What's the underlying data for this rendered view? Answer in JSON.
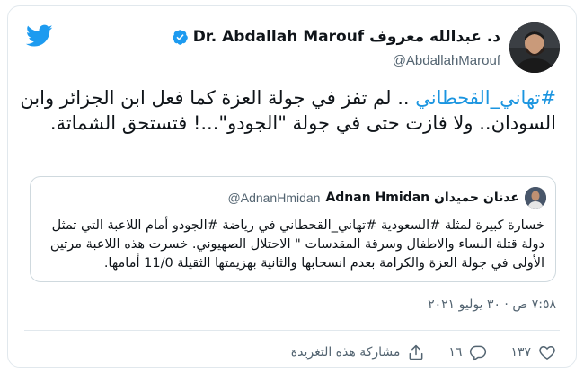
{
  "author": {
    "display_name": "Dr. Abdallah Marouf د. عبدالله معروف",
    "handle": "@AbdallahMarouf"
  },
  "tweet": {
    "hashtag": "#تهاني_القحطاني",
    "text_rest": " .. لم تفز في جولة العزة كما فعل ابن الجزائر وابن السودان.. ولا فازت حتى في جولة \"الجودو\"...! فتستحق الشماتة."
  },
  "quote": {
    "name": "Adnan Hmidan عدنان حميدان",
    "handle": "@AdnanHmidan",
    "text": "خسارة كبيرة لمثلة #السعودية #تهاني_القحطاني في رياضة #الجودو أمام اللاعبة التي تمثل دولة قتلة النساء والاطفال وسرقة المقدسات \" الاحتلال الصهيوني. خسرت هذه اللاعبة مرتين الأولى في جولة العزة والكرامة بعدم انسحابها والثانية بهزيمتها الثقيلة 11/0 أمامها."
  },
  "timestamp": "٧:٥٨ ص · ٣٠ يوليو ٢٠٢١",
  "actions": {
    "like_count": "١٣٧",
    "reply_count": "١٦",
    "share_label": "مشاركة هذه التغريدة"
  },
  "colors": {
    "twitter_blue": "#1d9bf0",
    "hashtag": "#1b95e0",
    "secondary_text": "#536471"
  },
  "icons": [
    "twitter-bird-icon",
    "verified-badge-icon",
    "heart-icon",
    "reply-icon",
    "share-icon"
  ]
}
